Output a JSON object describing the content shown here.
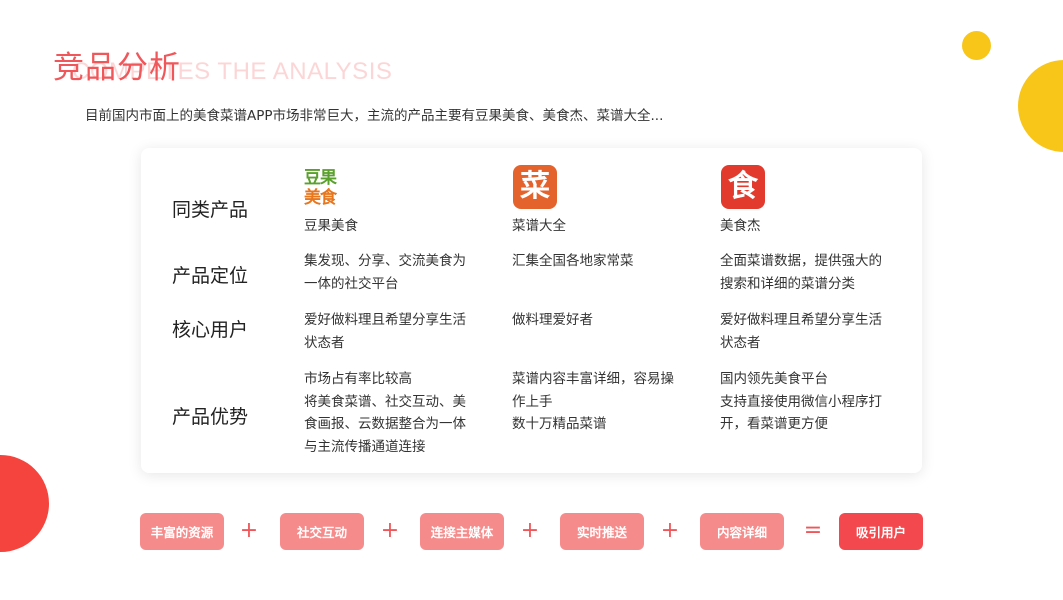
{
  "title": "竞品分析",
  "title_background": "COMPETES THE ANALYSIS",
  "subtitle": "目前国内市面上的美食菜谱APP市场非常巨大，主流的产品主要有豆果美食、美食杰、菜谱大全...",
  "rows": {
    "similar": "同类产品",
    "positioning": "产品定位",
    "core_users": "核心用户",
    "advantages": "产品优势"
  },
  "products": [
    {
      "logo_top": "豆果",
      "logo_bottom": "美食",
      "name": "豆果美食",
      "positioning": [
        "集发现、分享、交流美食为",
        "一体的社交平台"
      ],
      "core_users": [
        "爱好做料理且希望分享生活",
        "状态者"
      ],
      "advantages": [
        "市场占有率比较高",
        "将美食菜谱、社交互动、美",
        "食画报、云数据整合为一体",
        "与主流传播通道连接"
      ]
    },
    {
      "logo_char": "菜",
      "name": "菜谱大全",
      "positioning": [
        "汇集全国各地家常菜"
      ],
      "core_users": [
        "做料理爱好者"
      ],
      "advantages": [
        "菜谱内容丰富详细，容易操",
        "作上手",
        "数十万精品菜谱"
      ]
    },
    {
      "logo_char": "食",
      "name": "美食杰",
      "positioning": [
        "全面菜谱数据，提供强大的",
        "搜索和详细的菜谱分类"
      ],
      "core_users": [
        "爱好做料理且希望分享生活",
        "状态者"
      ],
      "advantages": [
        "国内领先美食平台",
        "支持直接使用微信小程序打",
        "开，看菜谱更方便"
      ]
    }
  ],
  "formula": {
    "items": [
      "丰富的资源",
      "社交互动",
      "连接主媒体",
      "实时推送",
      "内容详细"
    ],
    "plus": "+",
    "equals": "=",
    "result": "吸引用户"
  },
  "colors": {
    "accent": "#f0575a",
    "pill": "#f58b8b",
    "pill_result": "#f3484d",
    "yellow": "#f8c619",
    "red_circle": "#f5443e"
  }
}
